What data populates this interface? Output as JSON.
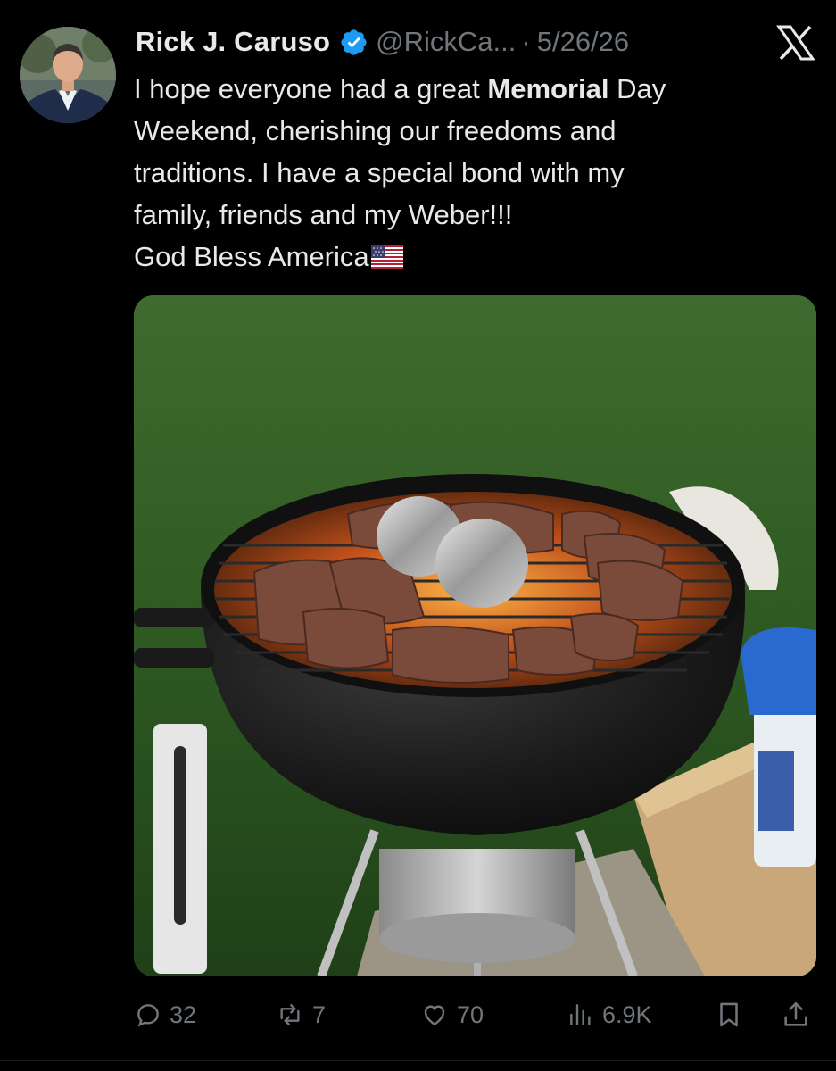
{
  "post": {
    "author_name": "Rick J. Caruso",
    "handle": "@RickCa...",
    "separator": "·",
    "date": "5/26/26",
    "text": {
      "line1_before": "I hope everyone had a great ",
      "line1_bold": "Memorial",
      "line1_after": " Day",
      "line2": "Weekend, cherishing our freedoms and",
      "line3": "traditions. I have a special bond with my",
      "line4": "family, friends and my Weber!!!",
      "line5": "God Bless America"
    },
    "emoji": "us-flag",
    "media_description": "photo"
  },
  "actions": {
    "replies": "32",
    "reposts": "7",
    "likes": "70",
    "views": "6.9K"
  },
  "colors": {
    "background": "#000000",
    "text": "#e7e9ea",
    "muted": "#71767b",
    "verified": "#1d9bf0"
  },
  "icons": [
    "verified-badge-icon",
    "x-logo-icon",
    "reply-icon",
    "repost-icon",
    "like-icon",
    "views-icon",
    "bookmark-icon",
    "share-icon"
  ]
}
